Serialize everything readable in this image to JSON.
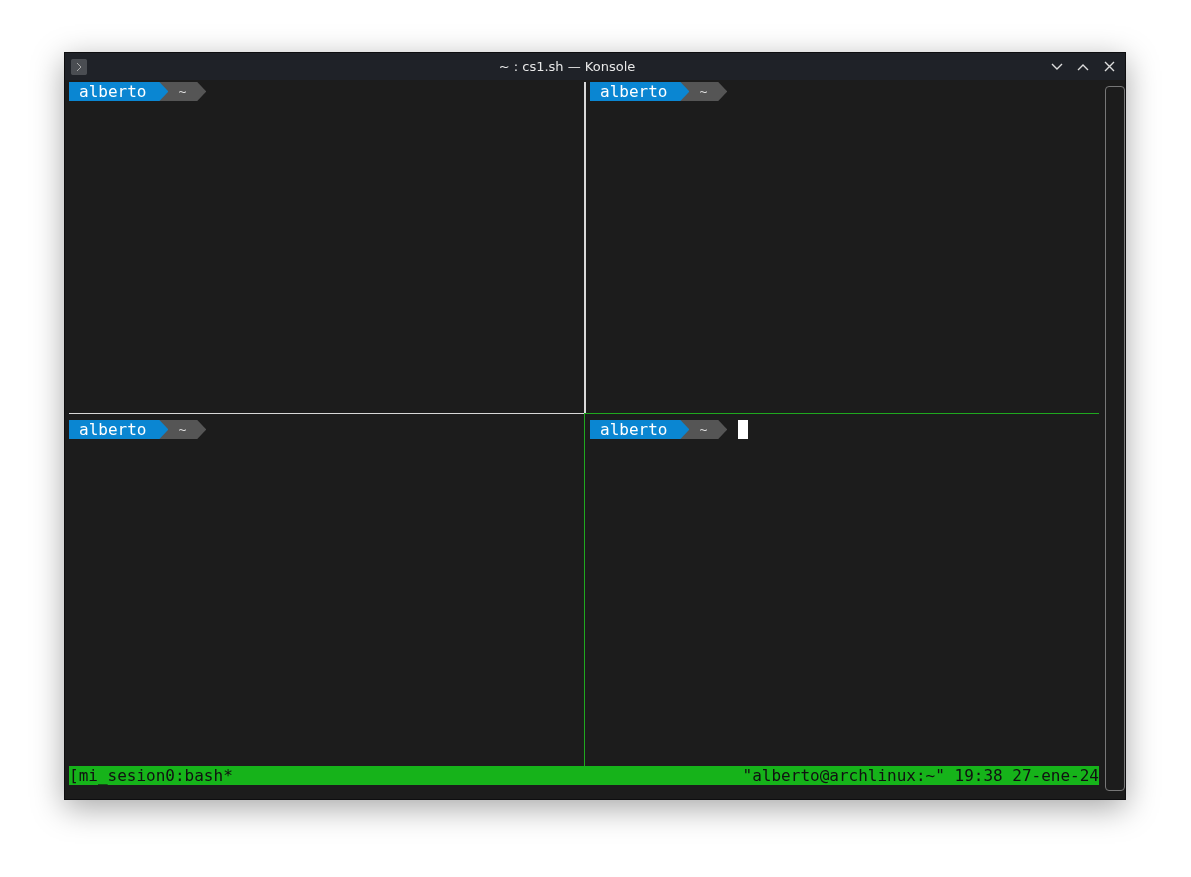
{
  "window": {
    "title": "~ : cs1.sh — Konsole"
  },
  "panes": [
    {
      "user": "alberto",
      "dir": "~",
      "selected": false
    },
    {
      "user": "alberto",
      "dir": "~",
      "selected": false
    },
    {
      "user": "alberto",
      "dir": "~",
      "selected": false
    },
    {
      "user": "alberto",
      "dir": "~",
      "selected": true
    }
  ],
  "status_bar": {
    "left": "[mi_sesion0:bash*",
    "right": "\"alberto@archlinux:~\" 19:38 27-ene-24"
  }
}
